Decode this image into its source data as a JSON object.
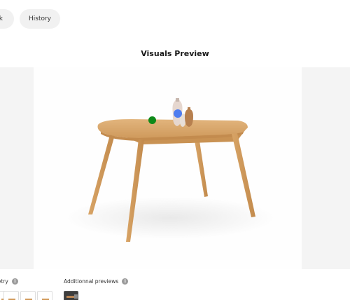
{
  "top_nav": {
    "left_tab_label": "k",
    "history_label": "History"
  },
  "preview": {
    "title": "Visuals Preview"
  },
  "geometry": {
    "label": "netry",
    "info_icon": "info-icon",
    "thumbnails": [
      "table-thumbnail-1",
      "table-thumbnail-2",
      "table-thumbnail-3",
      "table-thumbnail-4"
    ]
  },
  "additional_previews": {
    "label": "Additionnal previews",
    "info_icon": "info-icon"
  },
  "hotspots": {
    "colors": [
      "#0e8a19",
      "#4f7df0"
    ]
  },
  "info_glyph": "i"
}
